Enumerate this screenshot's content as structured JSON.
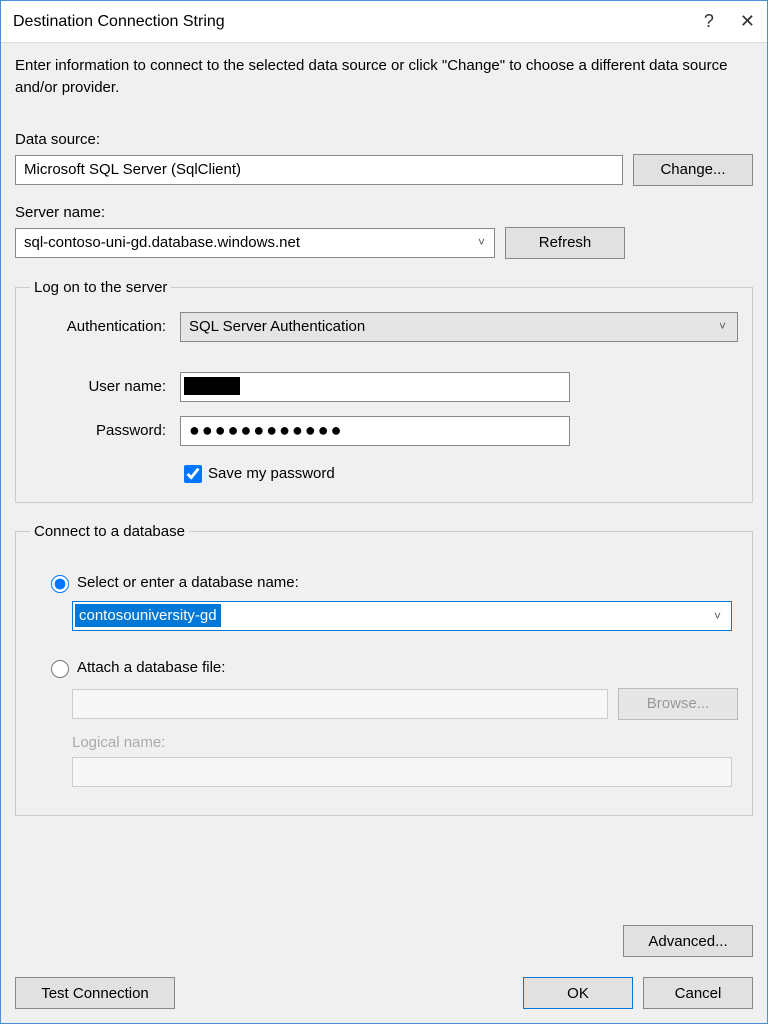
{
  "titlebar": {
    "title": "Destination Connection String"
  },
  "description": "Enter information to connect to the selected data source or click \"Change\" to choose a different data source and/or provider.",
  "data_source": {
    "label": "Data source:",
    "value": "Microsoft SQL Server (SqlClient)",
    "change_button": "Change..."
  },
  "server": {
    "label": "Server name:",
    "value": "sql-contoso-uni-gd.database.windows.net",
    "refresh_button": "Refresh"
  },
  "logon": {
    "legend": "Log on to the server",
    "auth_label": "Authentication:",
    "auth_value": "SQL Server Authentication",
    "user_label": "User name:",
    "user_value": "",
    "password_label": "Password:",
    "password_masked": "●●●●●●●●●●●●",
    "save_password_label": "Save my password",
    "save_password_checked": true
  },
  "connect_db": {
    "legend": "Connect to a database",
    "radio_select_label": "Select or enter a database name:",
    "selected_db": "contosouniversity-gd",
    "radio_attach_label": "Attach a database file:",
    "browse_button": "Browse...",
    "logical_name_label": "Logical name:"
  },
  "buttons": {
    "advanced": "Advanced...",
    "test_connection": "Test Connection",
    "ok": "OK",
    "cancel": "Cancel"
  }
}
